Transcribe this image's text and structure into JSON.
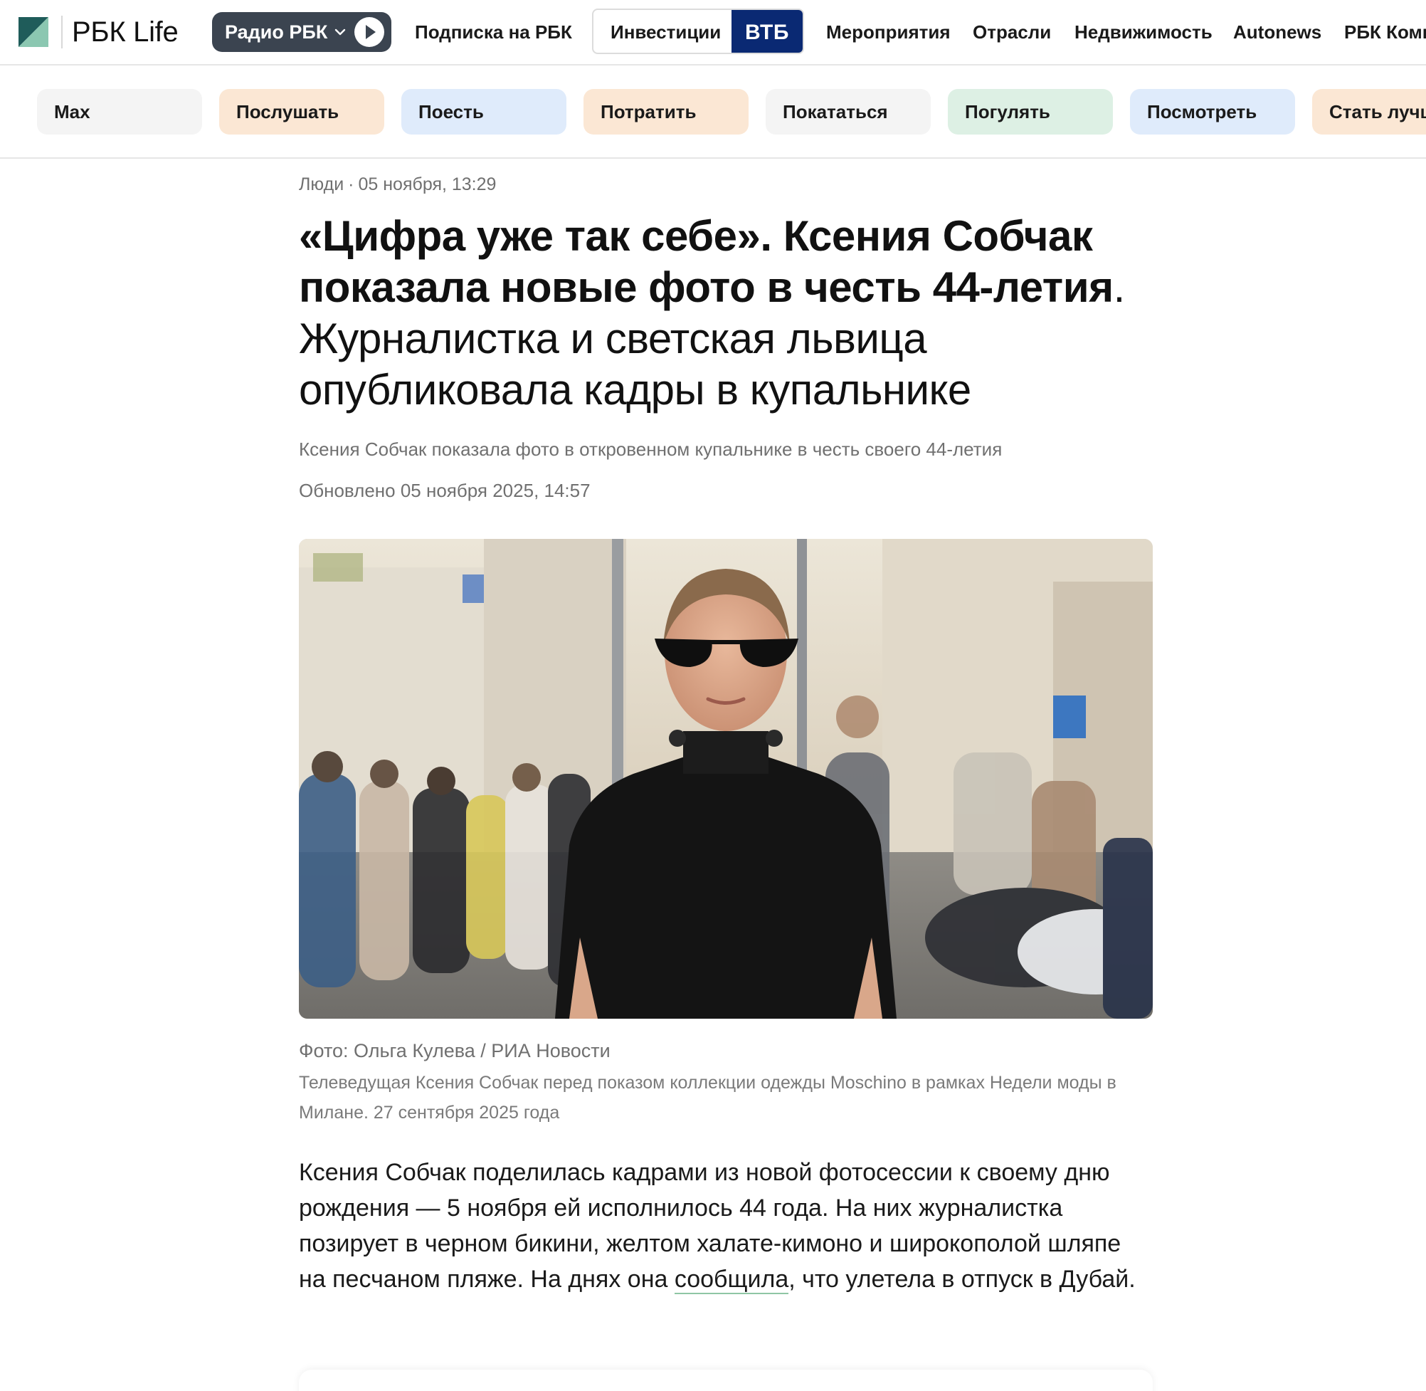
{
  "header": {
    "logo_text": "РБК Life",
    "logo_colors": {
      "dark": "#1f5c5a",
      "light": "#8bc7b1"
    },
    "radio_label": "Радио РБК",
    "subscription_link": "Подписка на РБК",
    "invest_label": "Инвестиции",
    "invest_partner": "ВТБ",
    "invest_partner_color": "#0a2973",
    "nav": [
      "Мероприятия",
      "Отрасли",
      "Недвижимость",
      "Autonews",
      "РБК Компании"
    ]
  },
  "categories": [
    {
      "label": "Max",
      "color": "#f4f4f4"
    },
    {
      "label": "Послушать",
      "color": "#fbe7d4"
    },
    {
      "label": "Поесть",
      "color": "#dfebfb"
    },
    {
      "label": "Потратить",
      "color": "#fbe7d4"
    },
    {
      "label": "Покататься",
      "color": "#f4f4f4"
    },
    {
      "label": "Погулять",
      "color": "#ddf0e4"
    },
    {
      "label": "Посмотреть",
      "color": "#dfebfb"
    },
    {
      "label": "Стать лучше",
      "color": "#fbe7d4"
    }
  ],
  "article": {
    "rubric": "Люди",
    "date": "05 ноября, 13:29",
    "title_bold": "«Цифра уже так себе». Ксения Собчак показала новые фото в честь 44-летия",
    "title_light": ". Журналистка и светская львица опубликовала кадры в купальнике",
    "lead": "Ксения Собчак показала фото в откровенном купальнике в честь своего 44-летия",
    "updated": "Обновлено 05 ноября 2025, 14:57",
    "photo_credit": "Фото: Ольга Кулева / РИА Новости",
    "photo_caption": "Телеведущая Ксения Собчак перед показом коллекции одежды Moschino в рамках Недели моды в Милане. 27 сентября 2025 года",
    "body_before_link": "Ксения Собчак поделилась кадрами из новой фотосессии к своему дню рождения — 5 ноября ей исполнилось 44 года. На них журналистка позирует в черном бикини, желтом халате-кимоно и широкополой шляпе на песчаном пляже. На днях она ",
    "body_link": "сообщила",
    "body_after_link": ", что улетела в отпуск в Дубай."
  }
}
